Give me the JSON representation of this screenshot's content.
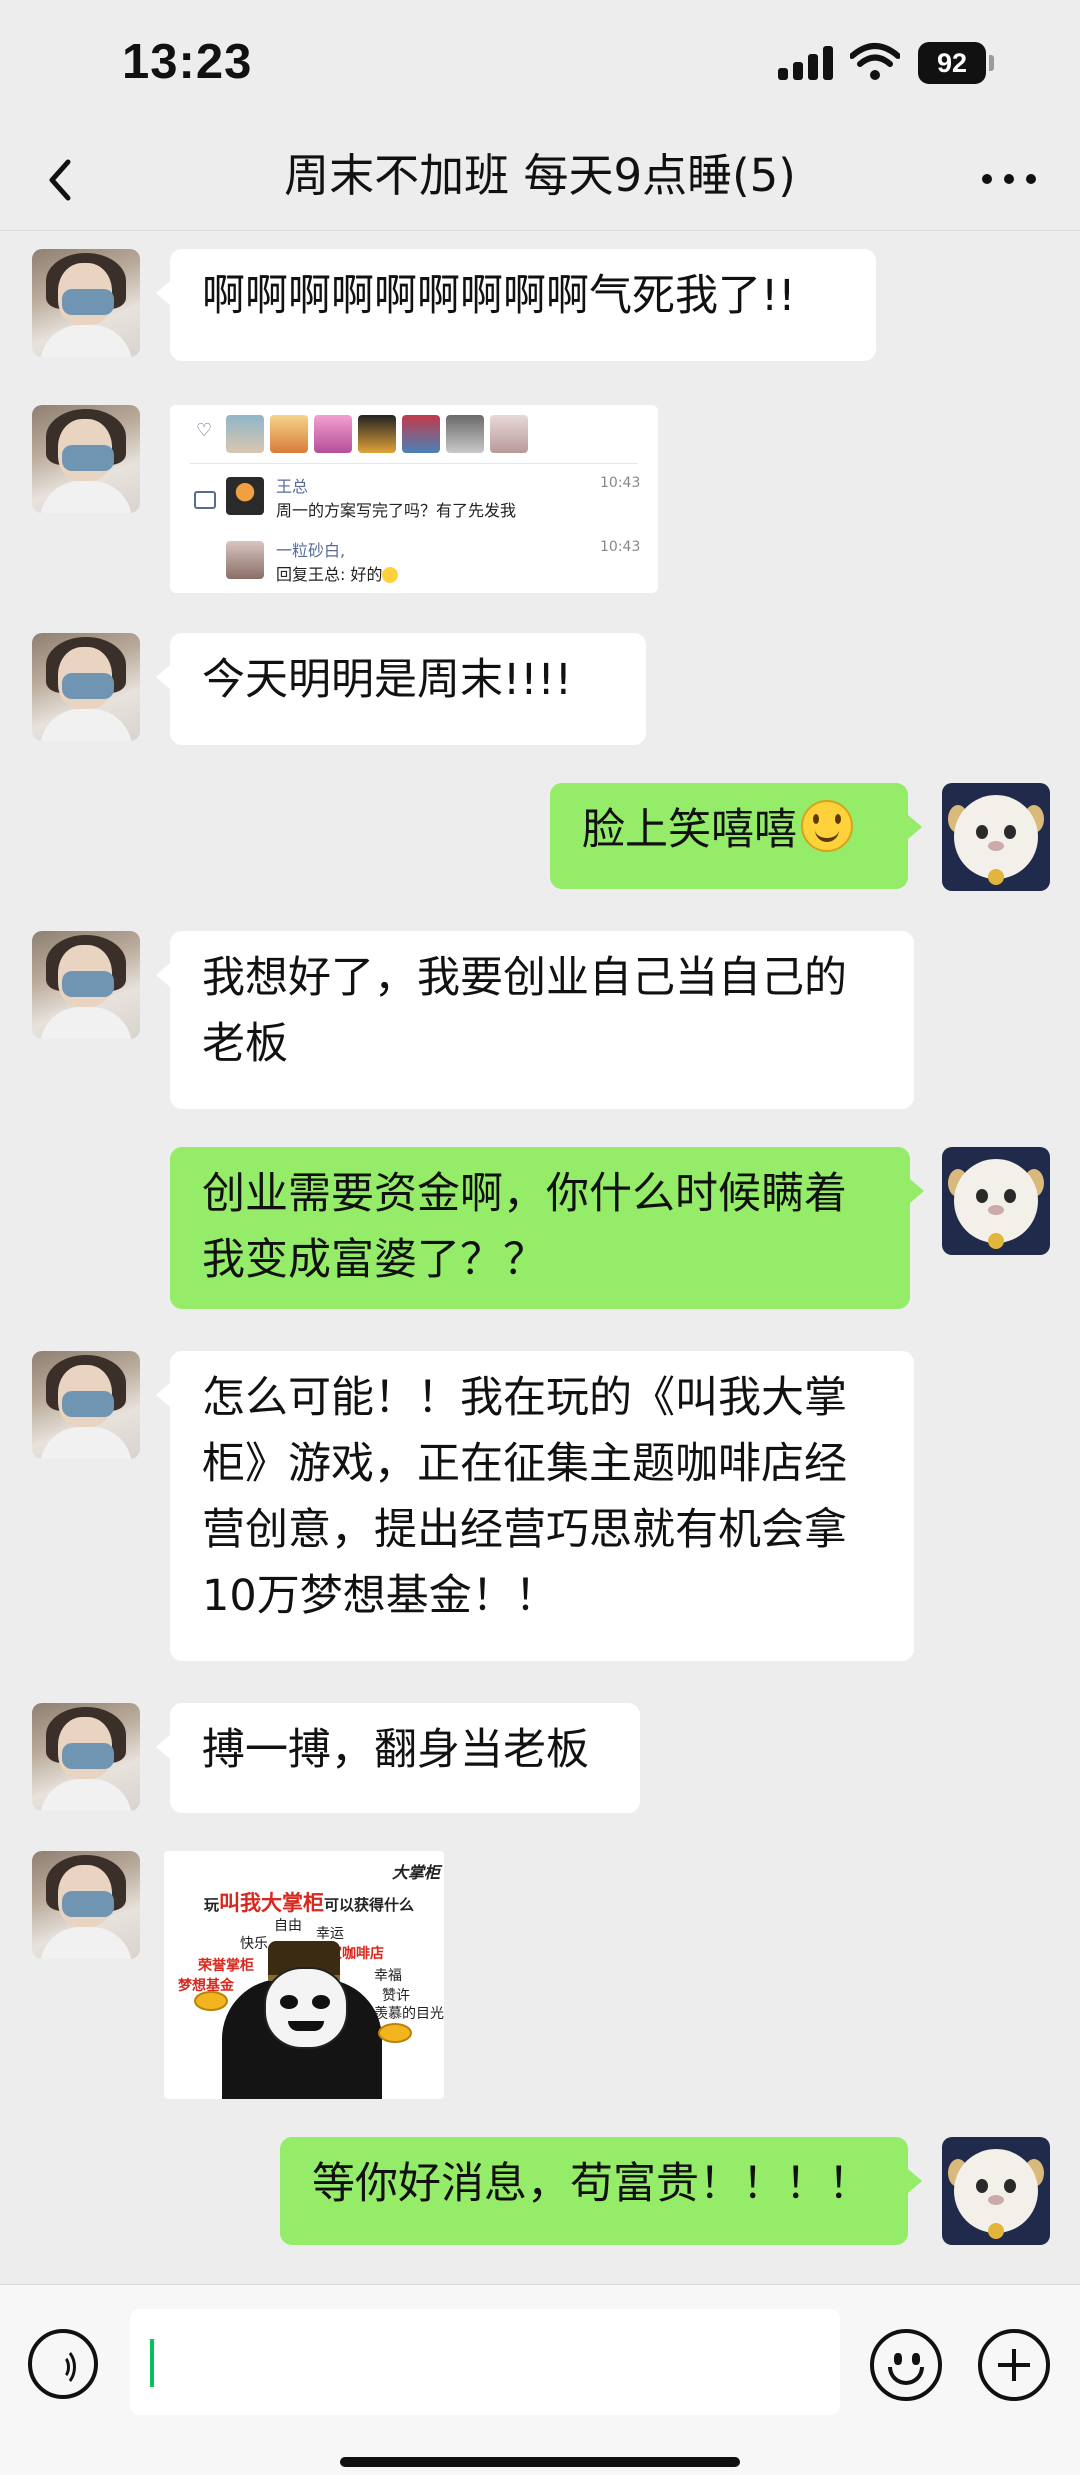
{
  "status_bar": {
    "time": "13:23",
    "battery": "92"
  },
  "header": {
    "title": "周末不加班 每天9点睡(5)"
  },
  "messages": [
    {
      "sender": "friend",
      "type": "text",
      "text": "啊啊啊啊啊啊啊啊啊气死我了!!"
    },
    {
      "sender": "friend",
      "type": "image",
      "image": "moments-screenshot"
    },
    {
      "sender": "friend",
      "type": "text",
      "text": "今天明明是周末!!!!"
    },
    {
      "sender": "self",
      "type": "text",
      "text": "脸上笑嘻嘻",
      "emoji": "smile-emoji"
    },
    {
      "sender": "friend",
      "type": "text",
      "lines": [
        "我想好了，我要创业自己当自己的",
        "老板"
      ]
    },
    {
      "sender": "self",
      "type": "text",
      "lines": [
        "创业需要资金啊，你什么时候瞒着",
        "我变成富婆了？？"
      ]
    },
    {
      "sender": "friend",
      "type": "text",
      "lines": [
        "怎么可能！！我在玩的《叫我大掌",
        "柜》游戏，正在征集主题咖啡店经",
        "营创意，提出经营巧思就有机会拿",
        "10万梦想基金！！"
      ]
    },
    {
      "sender": "friend",
      "type": "text",
      "text": "搏一搏，翻身当老板"
    },
    {
      "sender": "friend",
      "type": "image",
      "image": "panda-meme"
    },
    {
      "sender": "self",
      "type": "text",
      "text": "等你好消息，苟富贵！！！！"
    }
  ],
  "moments_screenshot": {
    "comment1": {
      "name": "王总",
      "text": "周一的方案写完了吗？有了先发我",
      "time": "10:43"
    },
    "comment2": {
      "name": "一粒砂白,",
      "text": "回复王总: 好的",
      "time": "10:43"
    }
  },
  "meme": {
    "title_prefix": "玩",
    "title_highlight": "叫我大掌柜",
    "title_suffix": "可以获得什么",
    "logo": "大掌柜",
    "words": [
      "自由",
      "幸运",
      "快乐",
      "一家咖啡店",
      "荣誉掌柜",
      "幸福",
      "梦想基金",
      "赞许",
      "别人羡慕的目光"
    ]
  },
  "input": {
    "value": ""
  },
  "colors": {
    "bubble_green": "#95ec69",
    "caret": "#07c160",
    "link_blue": "#576b95"
  }
}
